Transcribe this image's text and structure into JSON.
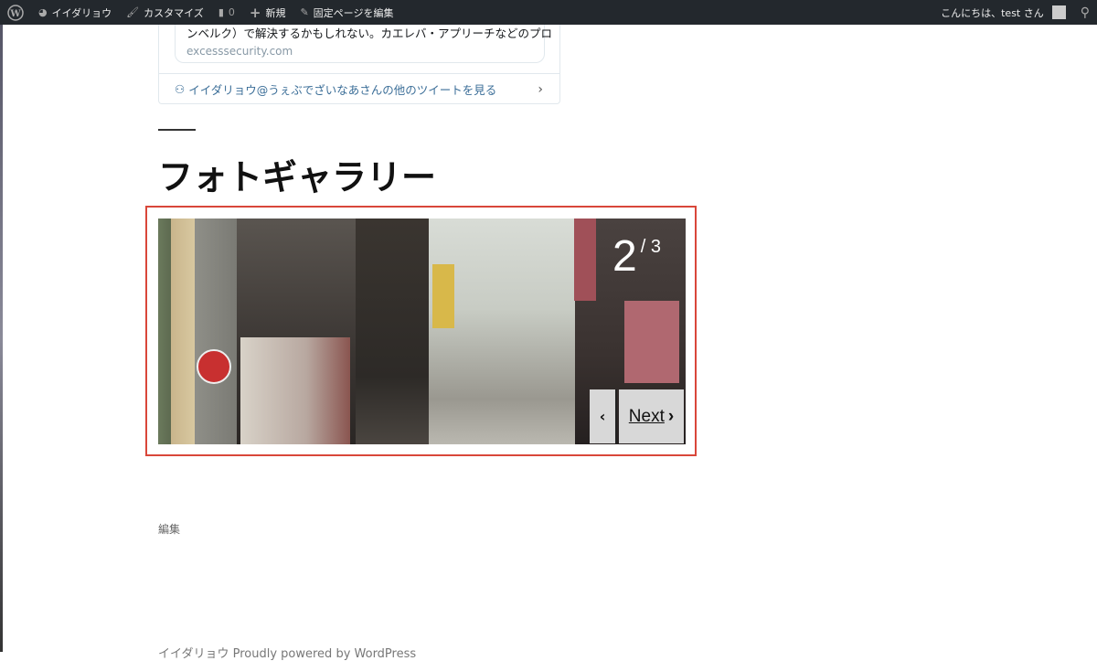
{
  "admin_bar": {
    "site_name": "イイダリョウ",
    "customize": "カスタマイズ",
    "comments_count": "0",
    "new": "新規",
    "edit_page": "固定ページを編集",
    "greeting": "こんにちは、test さん"
  },
  "tweet_card": {
    "text": "ンベルク）で解決するかもしれない。カエレバ・アプリーチなどのプロ",
    "domain": "excesssecurity.com",
    "more_link": "イイダリョウ@うぇぶでざいなあさんの他のツイートを見る"
  },
  "page": {
    "title": "フォトギャラリー",
    "edit_link": "編集",
    "footer": "イイダリョウ  Proudly powered by WordPress"
  },
  "gallery": {
    "current": "2",
    "total": "/ 3",
    "next_label": "Next",
    "border_color": "#d9473a"
  }
}
